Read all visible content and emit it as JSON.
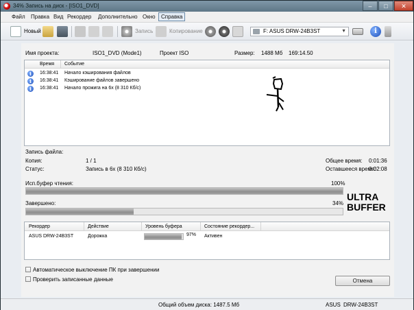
{
  "window": {
    "title": "34% Запись на диск - [ISO1_DVD]",
    "controls": {
      "minimize": "–",
      "maximize": "□",
      "close": "✕"
    }
  },
  "menu": [
    "Файл",
    "Правка",
    "Вид",
    "Рекордер",
    "Дополнительно",
    "Окно",
    "Справка"
  ],
  "toolbar": {
    "new_label": "Новый",
    "write_label": "Запись",
    "copy_label": "Копирование",
    "drive": "F: ASUS DRW-24B3ST"
  },
  "project": {
    "name_label": "Имя проекта:",
    "name_value": "ISO1_DVD (Mode1)",
    "type_value": "Проект ISO",
    "size_label": "Размер:",
    "size_value": "1488 Мб",
    "size_time": "169:14.50"
  },
  "log": {
    "columns": [
      "Время",
      "Событие"
    ],
    "rows": [
      {
        "time": "16:38:41",
        "event": "Начало кэширования файлов"
      },
      {
        "time": "16:38:41",
        "event": "Кэширование файлов завершено"
      },
      {
        "time": "16:38:41",
        "event": "Начало прожига на 6x (8 310 Кб/с)"
      }
    ]
  },
  "status": {
    "file_label": "Запись файла:",
    "copy_label": "Копия:",
    "copy_value": "1 / 1",
    "state_label": "Статус:",
    "state_value": "Запись в 6x (8 310 Кб/с)",
    "total_time_label": "Общее время:",
    "total_time_value": "0:01:36",
    "remaining_label": "Оставшееся время:",
    "remaining_value": "0:02:08"
  },
  "read_buffer": {
    "label": "Исп.буфер чтения:",
    "percent_text": "100%",
    "fraction": 1.0
  },
  "completed": {
    "label": "Завершено:",
    "percent_text": "34%",
    "fraction": 0.34
  },
  "ultrabuffer_logo": "ULTRA BUFFER",
  "recorder_table": {
    "columns": [
      "Рекордер",
      "Действие",
      "Уровень буфера",
      "Состояние рекордер..."
    ],
    "rows": [
      {
        "recorder": "ASUS DRW-24B3ST",
        "action": "Дорожка",
        "buffer_text": "97%",
        "buffer_fraction": 0.97,
        "state": "Активен"
      }
    ]
  },
  "options": {
    "auto_shutdown": "Автоматическое выключение ПК при завершении",
    "verify": "Проверить записанные данные"
  },
  "buttons": {
    "cancel": "Отмена"
  },
  "statusbar": {
    "total_size": "Общий объем диска: 1487.5 Мб",
    "drive_brand": "ASUS",
    "drive_model": "DRW-24B3ST"
  },
  "colors": {
    "progress_fill": "#9a9a9a",
    "info_icon": "#1f4fb8",
    "close_button": "#c4422c"
  },
  "icons": [
    "app-icon",
    "new-document-icon",
    "open-icon",
    "save-icon",
    "cut-icon",
    "copy-icon",
    "paste-icon",
    "write-disc-icon",
    "copy-disc-icon",
    "erase-disc-icon",
    "disc-info-icon",
    "drive-icon",
    "drive-tray-icon",
    "help-icon",
    "info-icon"
  ]
}
